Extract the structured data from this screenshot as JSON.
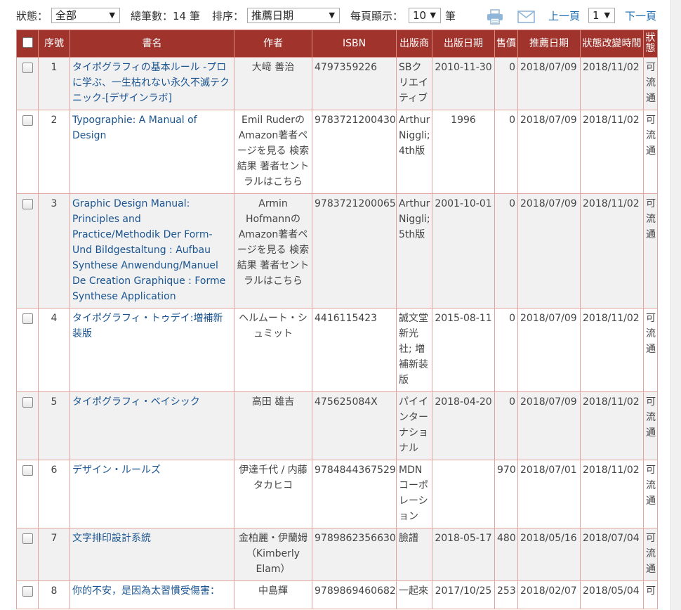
{
  "toolbar": {
    "status_label": "狀態：",
    "status_value": "全部",
    "total_label": "總筆數：14 筆",
    "sort_label": "排序：",
    "sort_value": "推薦日期",
    "per_page_label": "每頁顯示：",
    "per_page_value": "10",
    "per_page_unit": "筆",
    "prev_label": "上一頁",
    "page_value": "1",
    "next_label": "下一頁",
    "print_icon": "printer-icon",
    "mail_icon": "envelope-icon"
  },
  "table": {
    "headers": [
      "序號",
      "書名",
      "作者",
      "ISBN",
      "出版商",
      "出版日期",
      "售價",
      "推薦日期",
      "狀態改變時間",
      "狀態"
    ],
    "rows": [
      {
        "no": "1",
        "title": "タイポグラフィの基本ルール -プロに学ぶ、一生枯れない永久不滅テクニック-[デザインラボ]",
        "author": "大﨑 善治",
        "isbn": "4797359226",
        "publisher": "SBクリエイティブ",
        "pub_date": "2010-11-30",
        "price": "0",
        "rec_date": "2018/07/09",
        "change_date": "2018/11/02",
        "status": "可流通"
      },
      {
        "no": "2",
        "title": "Typographie: A Manual of Design",
        "author": "Emil RuderのAmazon著者ページを見る 検索結果 著者セントラルはこちら",
        "isbn": "9783721200430",
        "publisher": "Arthur Niggli; 4th版",
        "pub_date": "1996",
        "price": "0",
        "rec_date": "2018/07/09",
        "change_date": "2018/11/02",
        "status": "可流通"
      },
      {
        "no": "3",
        "title": "Graphic Design Manual: Principles and Practice/Methodik Der Form-Und Bildgestaltung : Aufbau Synthese Anwendung/Manuel De Creation Graphique : Forme Synthese Application",
        "author": "Armin HofmannのAmazon著者ページを見る 検索結果 著者セントラルはこちら",
        "isbn": "9783721200065",
        "publisher": "Arthur Niggli; 5th版",
        "pub_date": "2001-10-01",
        "price": "0",
        "rec_date": "2018/07/09",
        "change_date": "2018/11/02",
        "status": "可流通"
      },
      {
        "no": "4",
        "title": "タイポグラフィ・トゥデイ:増補新装版",
        "author": "ヘルムート・シュミット",
        "isbn": "4416115423",
        "publisher": "誠文堂新光社; 増補新装版",
        "pub_date": "2015-08-11",
        "price": "0",
        "rec_date": "2018/07/09",
        "change_date": "2018/11/02",
        "status": "可流通"
      },
      {
        "no": "5",
        "title": "タイポグラフィ・ベイシック",
        "author": "高田 雄吉",
        "isbn": "475625084X",
        "publisher": "パイインターナショナル",
        "pub_date": "2018-04-20",
        "price": "0",
        "rec_date": "2018/07/09",
        "change_date": "2018/11/02",
        "status": "可流通"
      },
      {
        "no": "6",
        "title": "デザイン・ルールズ",
        "author": "伊達千代 / 内藤タカヒコ",
        "isbn": "9784844367529",
        "publisher": "MDN コーポレーション",
        "pub_date": "",
        "price": "970",
        "rec_date": "2018/07/01",
        "change_date": "2018/11/02",
        "status": "可流通"
      },
      {
        "no": "7",
        "title": "文字排印設計系統",
        "author": "金柏麗・伊蘭姆（Kimberly Elam）",
        "isbn": "9789862356630",
        "publisher": "臉譜",
        "pub_date": "2018-05-17",
        "price": "480",
        "rec_date": "2018/05/16",
        "change_date": "2018/07/04",
        "status": "可流通"
      },
      {
        "no": "8",
        "title": "你的不安，是因為太習慣受傷害：",
        "author": "中島輝",
        "isbn": "9789869460682",
        "publisher": "一起來",
        "pub_date": "2017/10/25",
        "price": "253",
        "rec_date": "2018/02/07",
        "change_date": "2018/05/04",
        "status": "可"
      }
    ]
  }
}
